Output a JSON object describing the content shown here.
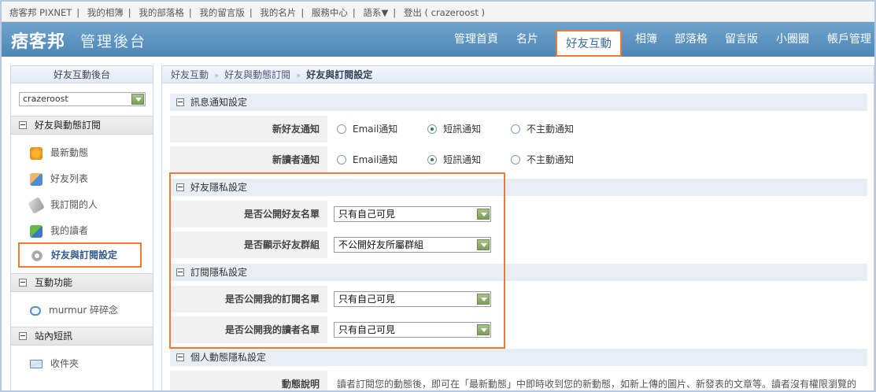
{
  "topbar": {
    "links": [
      "痞客邦 PIXNET",
      "我的相簿",
      "我的部落格",
      "我的留言版",
      "我的名片",
      "服務中心",
      "語系▼",
      "登出"
    ],
    "user": "( crazeroost )"
  },
  "header": {
    "logo": "痞客邦",
    "subtitle": "管理後台",
    "nav": [
      "管理首頁",
      "名片",
      "好友互動",
      "相簿",
      "部落格",
      "留言版",
      "小圈圈",
      "帳戶管理"
    ],
    "active_nav": "好友互動"
  },
  "sidebar": {
    "title": "好友互動後台",
    "account_select": "crazeroost",
    "sections": [
      {
        "label": "好友與動態訂閱",
        "items": [
          {
            "label": "最新動態",
            "icon": "star-icon"
          },
          {
            "label": "好友列表",
            "icon": "friends-icon"
          },
          {
            "label": "我訂閱的人",
            "icon": "tag-icon"
          },
          {
            "label": "我的讀者",
            "icon": "readers-icon"
          },
          {
            "label": "好友與訂閱設定",
            "icon": "gear-icon",
            "active": true
          }
        ]
      },
      {
        "label": "互動功能",
        "items": [
          {
            "label": "murmur 碎碎念",
            "icon": "speech-bubble-icon"
          }
        ]
      },
      {
        "label": "站內短訊",
        "items": [
          {
            "label": "收件夾",
            "icon": "envelope-icon"
          }
        ]
      }
    ]
  },
  "main": {
    "breadcrumb": [
      "好友互動",
      "好友與動態訂閱",
      "好友與訂閱設定"
    ],
    "notify_section": "訊息通知設定",
    "notify_rows": [
      {
        "label": "新好友通知",
        "options": [
          "Email通知",
          "短訊通知",
          "不主動通知"
        ],
        "selected": 1
      },
      {
        "label": "新讀者通知",
        "options": [
          "Email通知",
          "短訊通知",
          "不主動通知"
        ],
        "selected": 1
      }
    ],
    "friend_privacy_section": "好友隱私設定",
    "friend_privacy_rows": [
      {
        "label": "是否公開好友名單",
        "value": "只有自己可見"
      },
      {
        "label": "是否顯示好友群組",
        "value": "不公開好友所屬群組"
      }
    ],
    "sub_privacy_section": "訂閱隱私設定",
    "sub_privacy_rows": [
      {
        "label": "是否公開我的訂閱名單",
        "value": "只有自己可見"
      },
      {
        "label": "是否公開我的讀者名單",
        "value": "只有自己可見"
      }
    ],
    "activity_section": "個人動態隱私設定",
    "activity_row": {
      "label": "動態說明",
      "text": "讀者訂閱您的動態後，即可在「最新動態」中即時收到您的新動態，如新上傳的圖片、新發表的文章等。讀者沒有權限瀏覽的"
    }
  },
  "colors": {
    "header": "#5a91c0",
    "highlight": "#ee7b33"
  }
}
